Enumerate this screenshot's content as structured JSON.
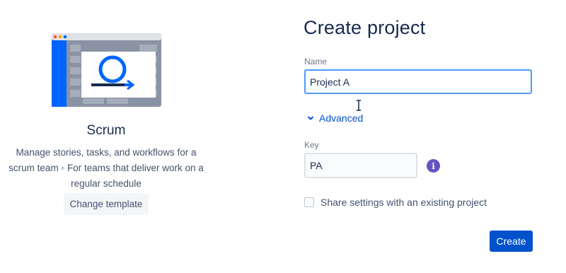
{
  "template": {
    "name": "Scrum",
    "description": "Manage stories, tasks, and workflows for a scrum team ◦ For teams that deliver work on a regular schedule",
    "change_button": "Change template",
    "illustration_icon": "scrum-cycle-icon"
  },
  "form": {
    "title": "Create project",
    "name_label": "Name",
    "name_value": "Project A",
    "advanced_label": "Advanced",
    "key_label": "Key",
    "key_value": "PA",
    "info_icon_glyph": "i",
    "share_label": "Share settings with an existing project",
    "create_button": "Create"
  },
  "colors": {
    "primary": "#0052cc",
    "focus_border": "#4c9aff",
    "info": "#6554c0",
    "text_dark": "#172b4d",
    "text_subtle": "#42526e"
  }
}
